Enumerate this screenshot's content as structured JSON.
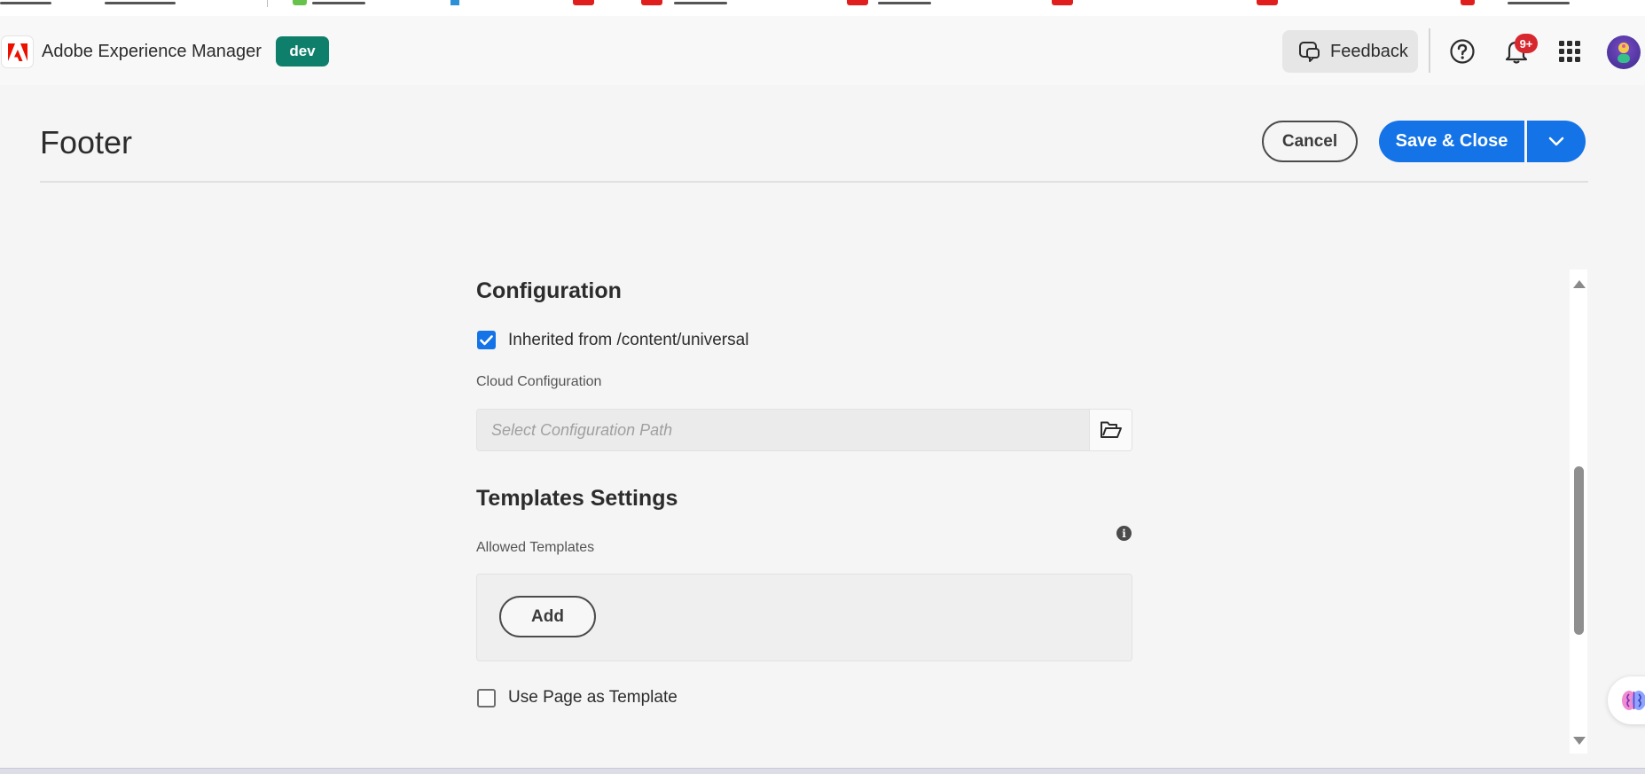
{
  "browser": {
    "bookmark_icons": [
      "page-icon",
      "sync-icon",
      "green-app-icon",
      "blue-app-icon",
      "red-app-icon",
      "red-app-icon",
      "red-app-icon",
      "red-app-icon",
      "red-app-icon",
      "red-figure-icon"
    ]
  },
  "header": {
    "app_name": "Adobe Experience Manager",
    "env_badge": "dev",
    "feedback_label": "Feedback",
    "notification_count": "9+",
    "icons": [
      "adobe-logo-icon",
      "feedback-icon",
      "help-icon",
      "bell-icon",
      "apps-grid-icon",
      "avatar"
    ]
  },
  "page": {
    "title": "Footer",
    "cancel_label": "Cancel",
    "save_label": "Save & Close"
  },
  "form": {
    "configuration": {
      "heading": "Configuration",
      "inherited_label": "Inherited from /content/universal",
      "inherited_checked": true,
      "cloud_label": "Cloud Configuration",
      "path_placeholder": "Select Configuration Path",
      "path_value": ""
    },
    "templates": {
      "heading": "Templates Settings",
      "allowed_label": "Allowed Templates",
      "add_label": "Add",
      "use_page_label": "Use Page as Template",
      "use_page_checked": false
    }
  },
  "colors": {
    "accent": "#1473e6",
    "env_badge": "#0e7f6a",
    "notification": "#d7282f",
    "adobe_red": "#eb1000"
  }
}
